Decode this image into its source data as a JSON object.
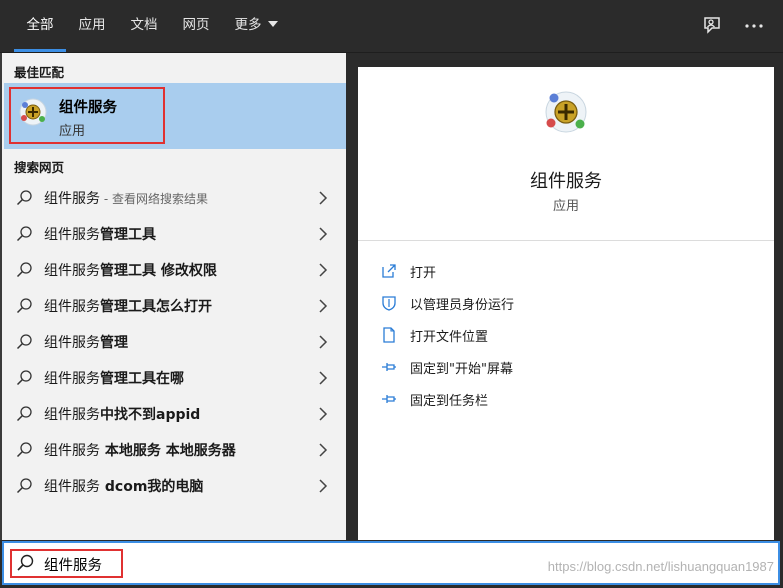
{
  "tabs": [
    {
      "label": "全部",
      "active": true
    },
    {
      "label": "应用",
      "active": false
    },
    {
      "label": "文档",
      "active": false
    },
    {
      "label": "网页",
      "active": false
    },
    {
      "label": "更多",
      "active": false
    }
  ],
  "top_icons": [
    "feedback-icon",
    "more-options-icon"
  ],
  "left": {
    "best_match_header": "最佳匹配",
    "best_match": {
      "title": "组件服务",
      "subtitle": "应用"
    },
    "web_header": "搜索网页",
    "results": [
      {
        "prefix": "组件服务",
        "bold": "",
        "hint": " - 查看网络搜索结果"
      },
      {
        "prefix": "组件服务",
        "bold": "管理工具",
        "hint": ""
      },
      {
        "prefix": "组件服务",
        "bold": "管理工具 修改权限",
        "hint": ""
      },
      {
        "prefix": "组件服务",
        "bold": "管理工具怎么打开",
        "hint": ""
      },
      {
        "prefix": "组件服务",
        "bold": "管理",
        "hint": ""
      },
      {
        "prefix": "组件服务",
        "bold": "管理工具在哪",
        "hint": ""
      },
      {
        "prefix": "组件服务",
        "bold": "中找不到appid",
        "hint": ""
      },
      {
        "prefix": "组件服务",
        "bold": " 本地服务 本地服务器",
        "hint": ""
      },
      {
        "prefix": "组件服务",
        "bold": " dcom我的电脑",
        "hint": ""
      }
    ]
  },
  "right": {
    "title": "组件服务",
    "subtitle": "应用",
    "actions": [
      {
        "label": "打开",
        "icon": "open-icon"
      },
      {
        "label": "以管理员身份运行",
        "icon": "shield-icon"
      },
      {
        "label": "打开文件位置",
        "icon": "file-location-icon"
      },
      {
        "label": "固定到\"开始\"屏幕",
        "icon": "pin-icon"
      },
      {
        "label": "固定到任务栏",
        "icon": "pin-icon"
      }
    ]
  },
  "search": {
    "value": "组件服务"
  },
  "watermark": "https://blog.csdn.net/lishuangquan1987",
  "colors": {
    "accent": "#3c8ee4",
    "highlight": "#a9cdee",
    "annotation": "#e03131"
  }
}
